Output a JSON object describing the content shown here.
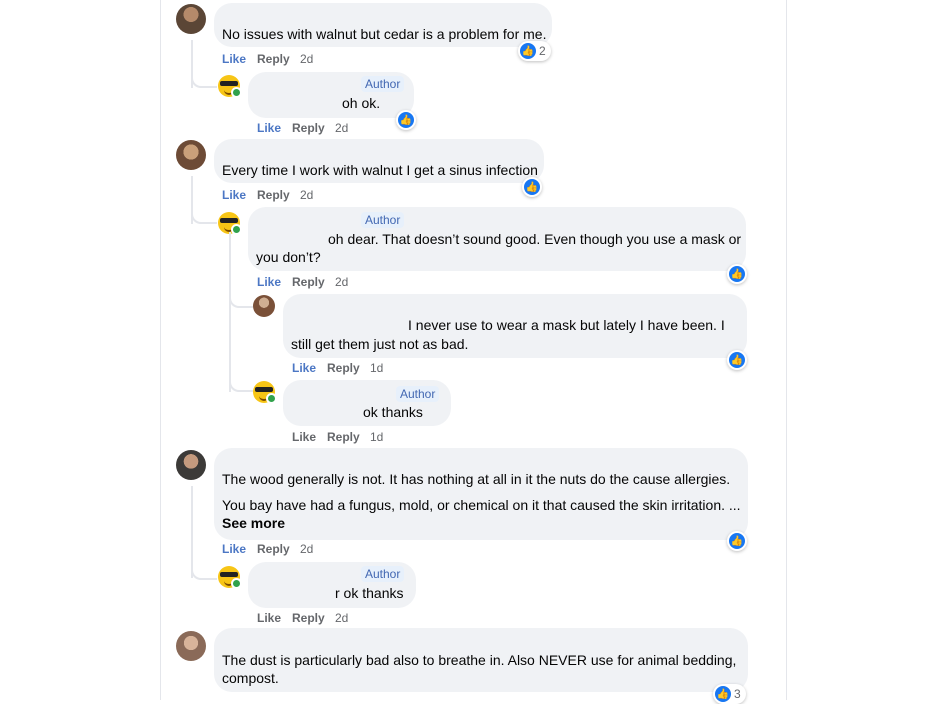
{
  "comments": [
    {
      "text": "No issues with walnut but cedar is a problem for me.",
      "like": "Like",
      "reply": "Reply",
      "time": "2d",
      "reaction_count": "2"
    },
    {
      "author_badge": "Author",
      "text": "oh ok.",
      "like": "Like",
      "reply": "Reply",
      "time": "2d"
    },
    {
      "text": "Every time I work with walnut I get a sinus infection",
      "like": "Like",
      "reply": "Reply",
      "time": "2d"
    },
    {
      "author_badge": "Author",
      "text_line1": "oh dear. That doesn’t sound good. Even though you use a mask or",
      "text_line2": "you don’t?",
      "like": "Like",
      "reply": "Reply",
      "time": "2d"
    },
    {
      "text_line1": "I never use to wear a mask but lately I have been. I",
      "text_line2": "still get them just not as bad.",
      "like": "Like",
      "reply": "Reply",
      "time": "1d"
    },
    {
      "author_badge": "Author",
      "text": "ok thanks",
      "like": "Like",
      "reply": "Reply",
      "time": "1d"
    },
    {
      "text_line1": "The wood generally is not. It has nothing at all in it the nuts do the cause allergies.",
      "text_line2": "You bay have had a fungus, mold, or chemical on it that caused the skin irritation. ...",
      "see_more": "See more",
      "like": "Like",
      "reply": "Reply",
      "time": "2d"
    },
    {
      "author_badge": "Author",
      "text": "r ok thanks",
      "like": "Like",
      "reply": "Reply",
      "time": "2d"
    },
    {
      "text_line1": "The dust is particularly bad also to breathe in. Also NEVER use for animal bedding,",
      "text_line2": "compost.",
      "reaction_count": "3"
    }
  ],
  "icons": {
    "like": "like-thumb-icon",
    "emoji": "sunglasses-emoji-icon"
  },
  "colors": {
    "like_blue": "#1877f2",
    "bubble": "#f0f2f5",
    "author_badge": "#e7f0fb"
  }
}
